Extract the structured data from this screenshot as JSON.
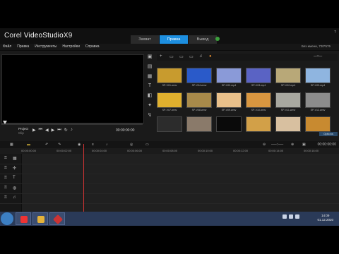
{
  "app": {
    "logo_prefix": "Corel",
    "logo_name": "VideoStudio",
    "logo_version": "X9"
  },
  "steps": [
    "Захват",
    "Правка",
    "Вывод"
  ],
  "active_step": "Правка",
  "window_controls": {
    "help": "?",
    "minimize": "_",
    "maximize": "□",
    "close": "×"
  },
  "menu": [
    "Файл",
    "Правка",
    "Инструменты",
    "Настройки",
    "Справка"
  ],
  "aspect_label": "Без имени, 720*576",
  "preview": {
    "project_label": "Project",
    "clip_label": "Clip",
    "timecode": "00:00:00:00"
  },
  "library": {
    "options_label": "Options",
    "thumbs": [
      {
        "name": "SP-V01.wmv",
        "color": "#c89b2e"
      },
      {
        "name": "SP-V04.wmv",
        "color": "#2a5ac9"
      },
      {
        "name": "SP-V02.mp4",
        "color": "#8a9ad8"
      },
      {
        "name": "SP-V03.mp4",
        "color": "#5a63c4"
      },
      {
        "name": "SP-V02.mp4",
        "color": "#b8a878"
      },
      {
        "name": "SP-V03.mp4",
        "color": "#8fb5e0"
      },
      {
        "name": "SP-V07.wmv",
        "color": "#e0b02e"
      },
      {
        "name": "SP-V08.wmv",
        "color": "#a88a4a"
      },
      {
        "name": "SP-V09.wmv",
        "color": "#e9c08a"
      },
      {
        "name": "SP-V10.wmv",
        "color": "#d89640"
      },
      {
        "name": "SP-V11.wmv",
        "color": "#a8a8a0"
      },
      {
        "name": "SP-V12.wmv",
        "color": "#8c8c8c"
      },
      {
        "name": "",
        "color": "#2c2c2c"
      },
      {
        "name": "",
        "color": "#8a7a6a"
      },
      {
        "name": "",
        "color": "#0a0a0a"
      },
      {
        "name": "",
        "color": "#d2a048"
      },
      {
        "name": "",
        "color": "#d8c0a0"
      },
      {
        "name": "",
        "color": "#c88a30"
      }
    ]
  },
  "timeline": {
    "ruler": [
      "00:00:00:00",
      "00:00:02:00",
      "00:00:04:00",
      "00:00:06:00",
      "00:00:08:00",
      "00:00:10:00",
      "00:00:12:00",
      "00:00:14:00",
      "00:00:16:00"
    ],
    "timecode": "00:00:00:00"
  },
  "taskbar": {
    "time": "14:09",
    "date": "01.12.2020"
  }
}
